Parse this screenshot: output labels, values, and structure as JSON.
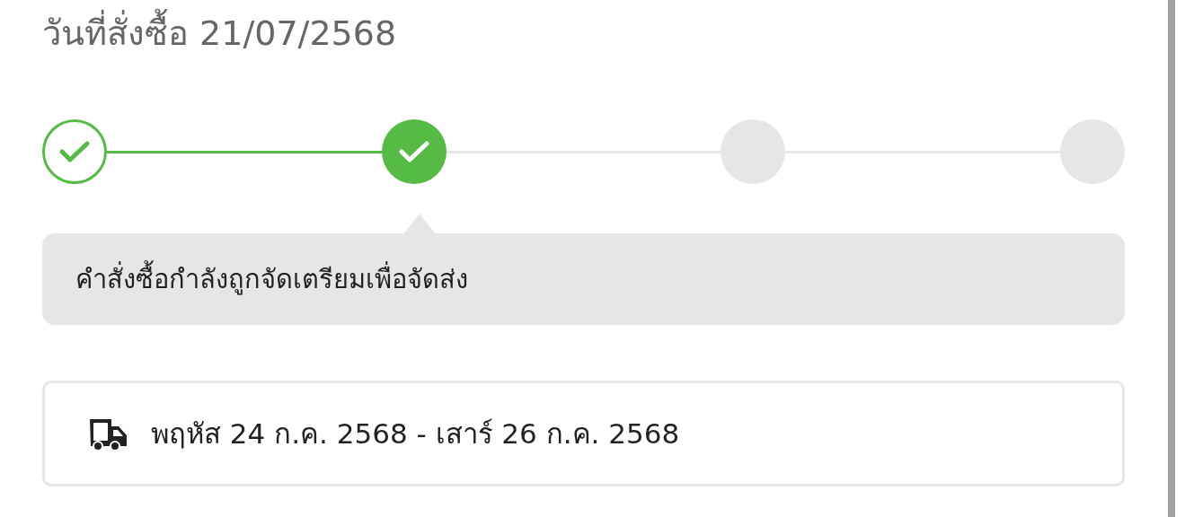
{
  "order_date": "วันที่สั่งซื้อ 21/07/2568",
  "steps": [
    {
      "kind": "done"
    },
    {
      "kind": "current"
    },
    {
      "kind": "pending"
    },
    {
      "kind": "pending"
    }
  ],
  "status_message": "คำสั่งซื้อกำลังถูกจัดเตรียมเพื่อจัดส่ง",
  "delivery": {
    "dates": "พฤหัส 24 ก.ค. 2568 - เสาร์ 26 ก.ค. 2568"
  }
}
